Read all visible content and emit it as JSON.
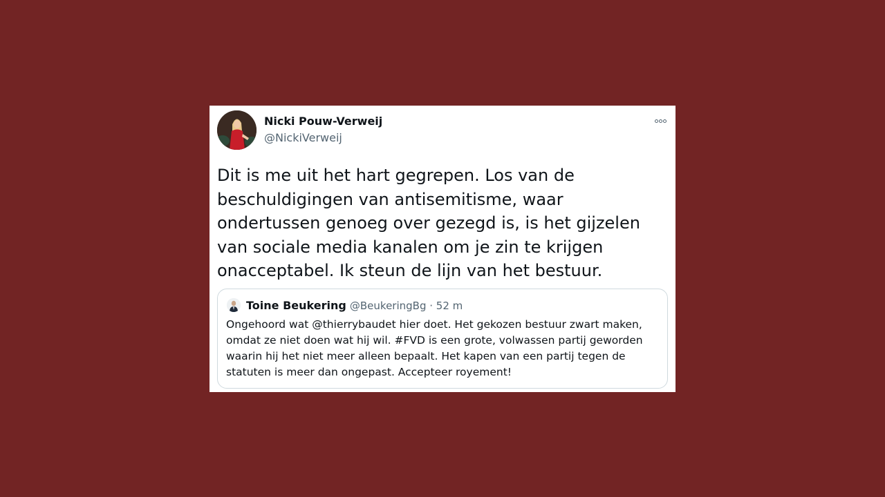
{
  "tweet": {
    "author_name": "Nicki Pouw-Verweij",
    "author_handle": "@NickiVerweij",
    "more_icon": "more-horizontal-icon",
    "text": "Dit is me uit het hart gegrepen. Los van de beschuldigingen van antisemitisme, waar ondertussen genoeg over gezegd is, is het gijzelen van sociale media kanalen om je zin te krijgen onacceptabel. Ik steun de lijn van het bestuur."
  },
  "quoted_tweet": {
    "author_name": "Toine Beukering",
    "author_handle": "@BeukeringBg",
    "separator": " · ",
    "time": "52 m",
    "text": "Ongehoord wat @thierrybaudet hier doet. Het gekozen bestuur zwart maken, omdat ze niet doen wat hij wil. #FVD is een grote, volwassen partij geworden waarin hij het niet meer alleen bepaalt. Het kapen van een partij tegen de statuten is meer dan ongepast. Accepteer royement!"
  },
  "colors": {
    "background": "#722424",
    "card": "#ffffff",
    "text": "#0f1419",
    "secondary_text": "#536471",
    "border": "#cfd9de"
  }
}
